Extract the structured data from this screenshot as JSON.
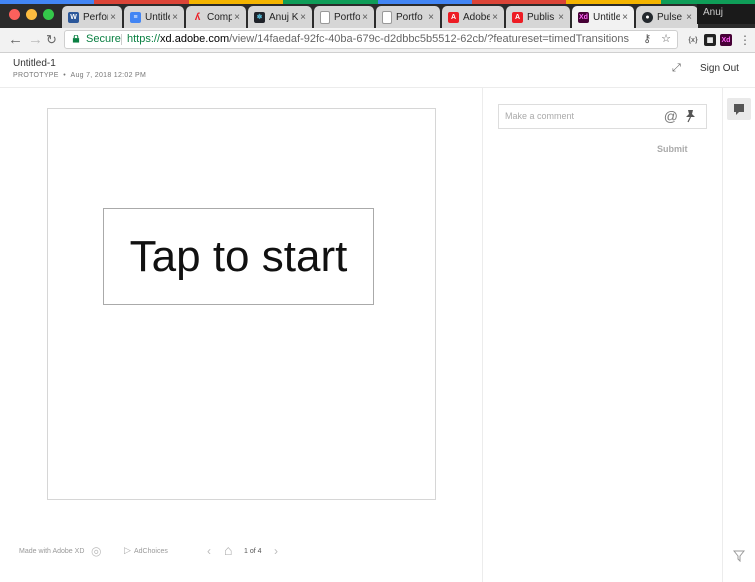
{
  "browser": {
    "profile": "Anuj",
    "tabs": [
      {
        "label": "Perfor",
        "icon": "word-icon",
        "color": "#2b579a",
        "active": false
      },
      {
        "label": "Untitle",
        "icon": "docs-icon",
        "color": "#4285f4",
        "active": false
      },
      {
        "label": "Comp",
        "icon": "acrobat-icon",
        "color": "#ec1c24",
        "active": false
      },
      {
        "label": "Anuj K",
        "icon": "react-icon",
        "color": "#20232a",
        "active": false
      },
      {
        "label": "Portfo",
        "icon": "page-icon",
        "color": "#bbbbbb",
        "active": false
      },
      {
        "label": "Portfo",
        "icon": "page-icon",
        "color": "#bbbbbb",
        "active": false
      },
      {
        "label": "Adobe",
        "icon": "adobe-icon",
        "color": "#ed1c24",
        "active": false
      },
      {
        "label": "Publis",
        "icon": "adobe-icon",
        "color": "#ed1c24",
        "active": false
      },
      {
        "label": "Untitle",
        "icon": "xd-icon",
        "color": "#470137",
        "active": true
      },
      {
        "label": "Pulse",
        "icon": "github-icon",
        "color": "#24292e",
        "active": false
      }
    ],
    "close_glyph": "×",
    "secure_label": "Secure",
    "url_scheme": "https://",
    "url_host": "xd.adobe.com",
    "url_path": "/view/14faedaf-92fc-40ba-679c-d2dbbc5b5512-62cb/?featureset=timedTransitions",
    "ext1": "{x}",
    "ext2": "Xd"
  },
  "header": {
    "title": "Untitled-1",
    "kind": "PROTOTYPE",
    "date": "Aug 7, 2018 12:02 PM",
    "sign_out": "Sign Out"
  },
  "artboard": {
    "button_text": "Tap to start"
  },
  "footer": {
    "made_with": "Made with Adobe XD",
    "adchoices": "AdChoices",
    "page_indicator": "1 of 4"
  },
  "comments": {
    "placeholder": "Make a comment",
    "at_symbol": "@",
    "submit": "Submit"
  },
  "colors": {
    "secure_green": "#0b8043",
    "xd_purple": "#470137"
  }
}
